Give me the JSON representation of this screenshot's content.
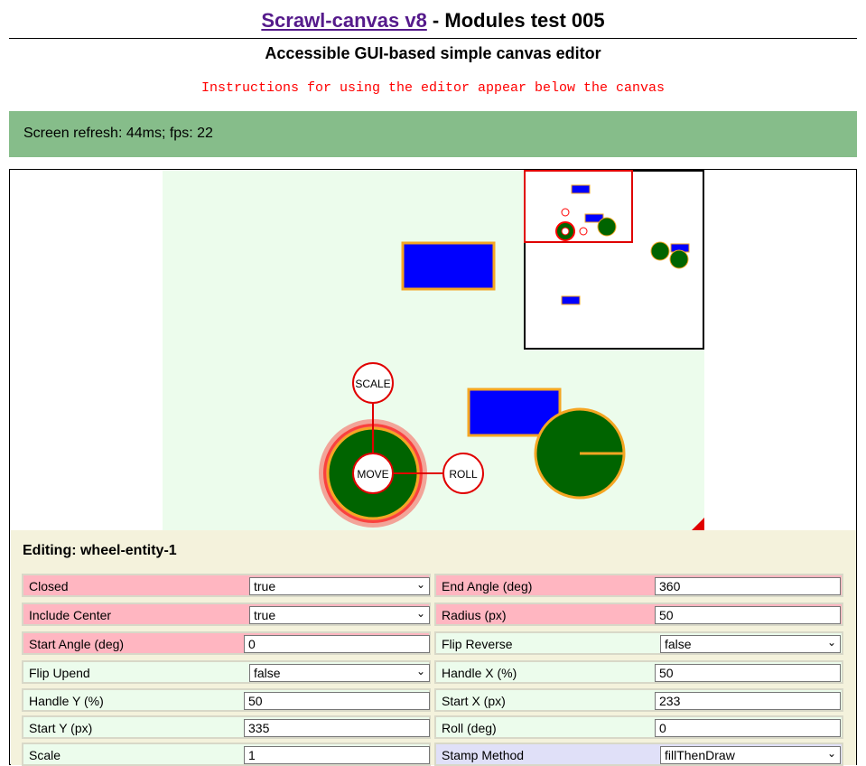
{
  "header": {
    "title_link": "Scrawl-canvas v8",
    "title_rest": " - Modules test 005",
    "subtitle": "Accessible GUI-based simple canvas editor",
    "instructions": "Instructions for using the editor appear below the canvas"
  },
  "status": {
    "refresh_text": "Screen refresh: 44ms; fps: 22"
  },
  "canvas": {
    "handles": {
      "scale": "SCALE",
      "move": "MOVE",
      "roll": "ROLL"
    },
    "colors": {
      "background": "#ecfcec",
      "block": "#0000ff",
      "wheel": "#006400",
      "stroke": "#f5a623",
      "handle": "#ff0000"
    }
  },
  "editor": {
    "heading": "Editing: wheel-entity-1",
    "fields": [
      {
        "label": "Closed",
        "value": "true",
        "type": "select",
        "color": "pink"
      },
      {
        "label": "End Angle (deg)",
        "value": "360",
        "type": "input",
        "color": "pink"
      },
      {
        "label": "Include Center",
        "value": "true",
        "type": "select",
        "color": "pink"
      },
      {
        "label": "Radius (px)",
        "value": "50",
        "type": "input",
        "color": "pink"
      },
      {
        "label": "Start Angle (deg)",
        "value": "0",
        "type": "input",
        "color": "pink"
      },
      {
        "label": "Flip Reverse",
        "value": "false",
        "type": "select",
        "color": "green"
      },
      {
        "label": "Flip Upend",
        "value": "false",
        "type": "select",
        "color": "green"
      },
      {
        "label": "Handle X (%)",
        "value": "50",
        "type": "input",
        "color": "green"
      },
      {
        "label": "Handle Y (%)",
        "value": "50",
        "type": "input",
        "color": "green"
      },
      {
        "label": "Start X (px)",
        "value": "233",
        "type": "input",
        "color": "green"
      },
      {
        "label": "Start Y (px)",
        "value": "335",
        "type": "input",
        "color": "green"
      },
      {
        "label": "Roll (deg)",
        "value": "0",
        "type": "input",
        "color": "green"
      },
      {
        "label": "Scale",
        "value": "1",
        "type": "input",
        "color": "green"
      },
      {
        "label": "Stamp Method",
        "value": "fillThenDraw",
        "type": "select",
        "color": "lav"
      }
    ]
  }
}
